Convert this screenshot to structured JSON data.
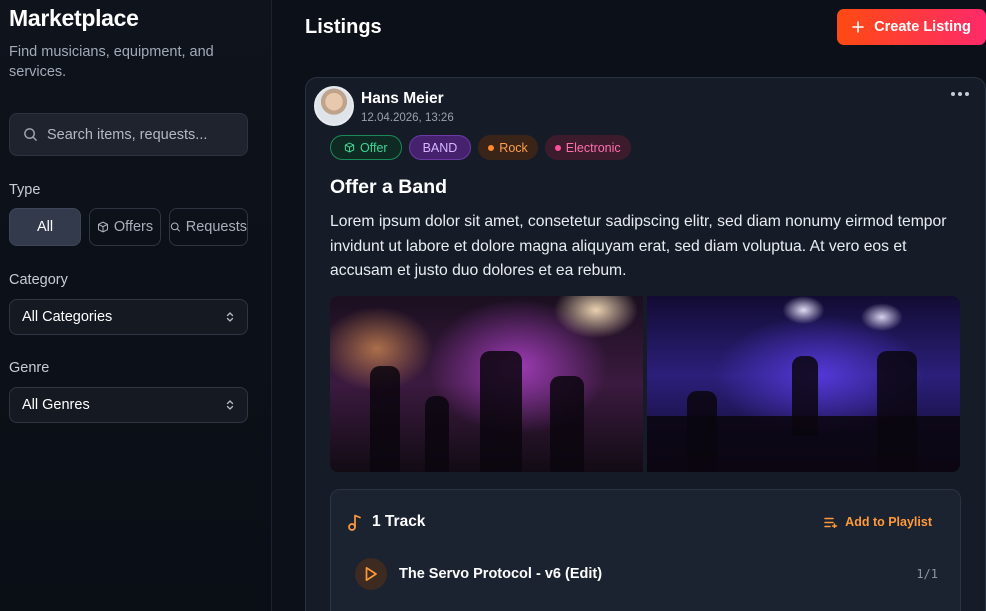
{
  "sidebar": {
    "title": "Marketplace",
    "subtitle": "Find musicians, equipment, and services.",
    "search": {
      "placeholder": "Search items, requests..."
    },
    "type_label": "Type",
    "type_options": [
      {
        "label": "All",
        "active": true
      },
      {
        "label": "Offers",
        "icon": "box-icon"
      },
      {
        "label": "Requests",
        "icon": "search-icon"
      }
    ],
    "category_label": "Category",
    "category_value": "All Categories",
    "genre_label": "Genre",
    "genre_value": "All Genres"
  },
  "main": {
    "title": "Listings",
    "create_label": "Create Listing"
  },
  "listing": {
    "author": "Hans Meier",
    "date": "12.04.2026, 13:26",
    "tags": [
      {
        "label": "Offer",
        "kind": "offer",
        "color": "#3fd596"
      },
      {
        "label": "BAND",
        "kind": "band",
        "color": "#d7b6ff"
      },
      {
        "label": "Rock",
        "kind": "genre",
        "color": "#ff9f4a"
      },
      {
        "label": "Electronic",
        "kind": "genre",
        "color": "#ff6fae"
      }
    ],
    "title": "Offer a Band",
    "body": "Lorem ipsum dolor sit amet, consetetur sadipscing elitr, sed diam nonumy eirmod tempor invidunt ut labore et dolore magna aliquyam erat, sed diam voluptua. At vero eos et accusam et justo duo dolores et ea rebum.",
    "tracks": {
      "heading": "1 Track",
      "add_label": "Add to Playlist",
      "items": [
        {
          "name": "The Servo Protocol - v6 (Edit)",
          "position": "1/1"
        }
      ]
    }
  },
  "colors": {
    "accent_orange": "#ff9a3a",
    "create_gradient_start": "#ff4a12",
    "create_gradient_end": "#ff2a6a"
  }
}
